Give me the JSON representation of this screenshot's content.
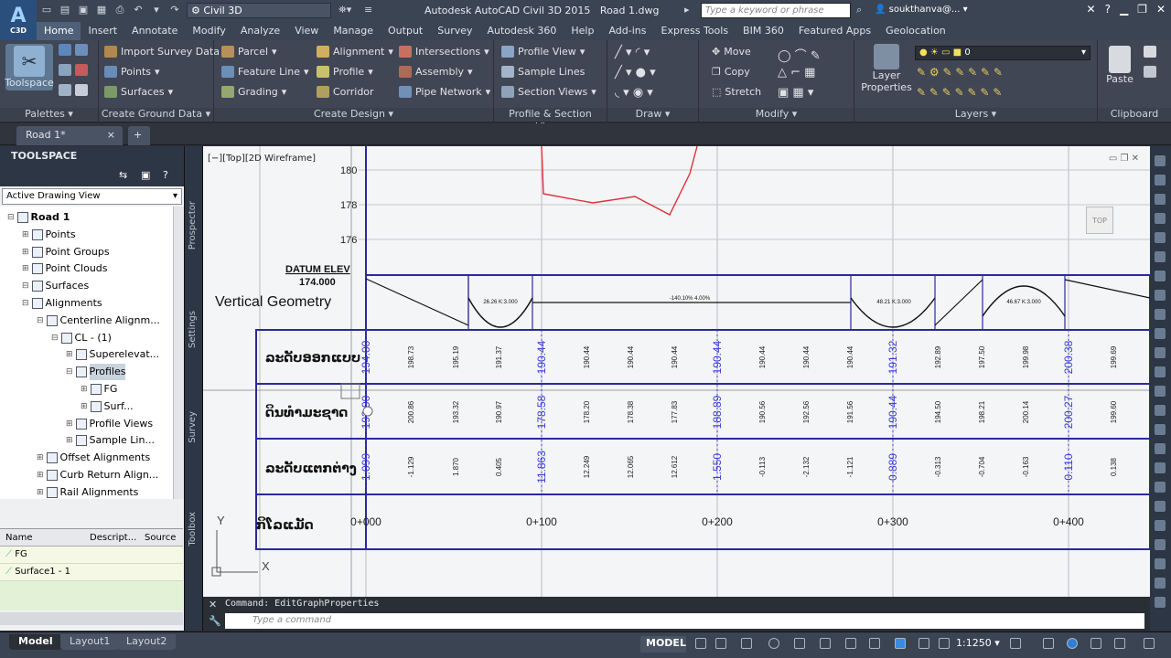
{
  "app": {
    "logo_text": "C3D",
    "title": "Autodesk AutoCAD Civil 3D 2015",
    "doc_title": "Road 1.dwg",
    "workspace": "Civil 3D",
    "search_placeholder": "Type a keyword or phrase",
    "user": "soukthanva@..."
  },
  "tabs": [
    "Home",
    "Insert",
    "Annotate",
    "Modify",
    "Analyze",
    "View",
    "Manage",
    "Output",
    "Survey",
    "Autodesk 360",
    "Help",
    "Add-ins",
    "Express Tools",
    "BIM 360",
    "Featured Apps",
    "Geolocation"
  ],
  "ribbon": {
    "palettes": {
      "label": "Palettes",
      "toolspace": "Toolspace"
    },
    "ground": {
      "label": "Create Ground Data",
      "items": [
        "Import Survey Data",
        "Points",
        "Surfaces"
      ]
    },
    "design": {
      "label": "Create Design",
      "items": [
        "Parcel",
        "Feature Line",
        "Grading",
        "Alignment",
        "Profile",
        "Corridor",
        "Intersections",
        "Assembly",
        "Pipe Network"
      ]
    },
    "profile": {
      "label": "Profile & Section Views",
      "items": [
        "Profile View",
        "Sample Lines",
        "Section Views"
      ]
    },
    "draw": {
      "label": "Draw"
    },
    "modify": {
      "label": "Modify",
      "items": [
        "Move",
        "Copy",
        "Stretch"
      ]
    },
    "layers": {
      "label": "Layers",
      "layer_props": "Layer Properties",
      "current_layer": "0"
    },
    "clipboard": {
      "label": "Clipboard",
      "paste": "Paste"
    }
  },
  "doc_tabs": [
    "Road 1*",
    "+"
  ],
  "toolspace": {
    "header": "TOOLSPACE",
    "view": "Active Drawing View",
    "tree": [
      "Road 1",
      "Points",
      "Point Groups",
      "Point Clouds",
      "Surfaces",
      "Alignments",
      "Centerline Alignm...",
      "CL - (1)",
      "Superelevat...",
      "Profiles",
      "FG",
      "Surf...",
      "Profile Views",
      "Sample Lin...",
      "Offset Alignments",
      "Curb Return Align...",
      "Rail Alignments"
    ],
    "list_columns": [
      "Name",
      "Descript...",
      "Source"
    ],
    "list_rows": [
      "FG",
      "Surface1 - 1"
    ],
    "side_tabs": [
      "Prospector",
      "Settings",
      "Survey",
      "Toolbox"
    ]
  },
  "viewport": {
    "label": "[−][Top][2D Wireframe]",
    "nav_top": "TOP",
    "axis_y": "Y",
    "axis_x": "X"
  },
  "profile": {
    "elev_ticks": [
      "180",
      "178",
      "176"
    ],
    "datum_title": "DATUM ELEV",
    "datum_value": "174.000",
    "vertical_geometry": "Vertical Geometry",
    "row_labels": [
      "ລະດັບອອກແບບ",
      "ດິນທຳມະຊາດ",
      "ລະດັບແຕກຕ່າງ",
      "ກິໂລແມັດ"
    ],
    "design_values": [
      "194.00",
      "198.73",
      "195.19",
      "191.37",
      "190.44",
      "190.44",
      "190.44",
      "190.44",
      "190.44",
      "190.44",
      "190.44",
      "190.44",
      "191.32",
      "192.89",
      "197.50",
      "199.98",
      "200.38",
      "199.69"
    ],
    "ground_values": [
      "192.90",
      "200.86",
      "193.32",
      "190.97",
      "178.58",
      "178.20",
      "178.38",
      "177.83",
      "188.89",
      "190.56",
      "192.56",
      "191.56",
      "190.44",
      "194.50",
      "198.21",
      "200.14",
      "200.27",
      "199.60"
    ],
    "cutfill_values": [
      "1.099",
      "-1.129",
      "1.870",
      "0.405",
      "11.863",
      "12.249",
      "12.065",
      "12.612",
      "1.550",
      "-0.113",
      "-2.132",
      "-1.121",
      "0.889",
      "-0.313",
      "-0.704",
      "-0.163",
      "0.110",
      "0.138"
    ],
    "stations": [
      "0+000",
      "0+100",
      "0+200",
      "0+300",
      "0+400"
    ],
    "curve_labels": [
      "26.26 K:3.000",
      "48.21 K:3.000",
      "46.67 K:3.000",
      "-140.10% 4.00%"
    ]
  },
  "command": {
    "history": "Command: EditGraphProperties",
    "placeholder": "Type a command"
  },
  "status": {
    "layout_tabs": [
      "Model",
      "Layout1",
      "Layout2"
    ],
    "model": "MODEL",
    "scale": "1:1250"
  }
}
